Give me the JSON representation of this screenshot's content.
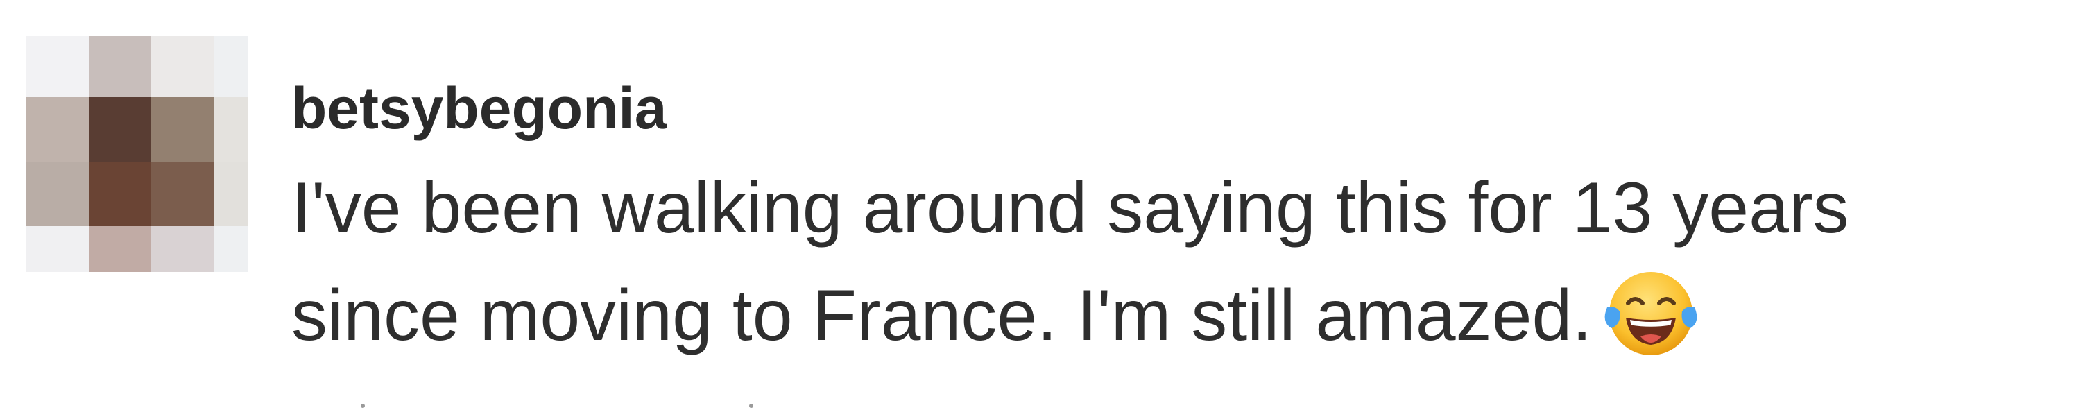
{
  "comment": {
    "author": {
      "username": "betsybegonia",
      "avatar_pixels": [
        [
          "#f2f2f4",
          "#c8bebb",
          "#ebe9e8",
          "#eef0f2"
        ],
        [
          "#c0b3ac",
          "#593d33",
          "#938070",
          "#e4e2de"
        ],
        [
          "#b9ada6",
          "#6a4434",
          "#7b5d4d",
          "#e2e0dc"
        ],
        [
          "#f0f0f2",
          "#c1aba5",
          "#d9d2d3",
          "#eef0f2"
        ]
      ]
    },
    "text_lines": [
      "I've been walking around saying this for 13 years",
      "since moving to France. I'm still amazed."
    ],
    "emoji": "face-with-tears-of-joy-icon"
  }
}
